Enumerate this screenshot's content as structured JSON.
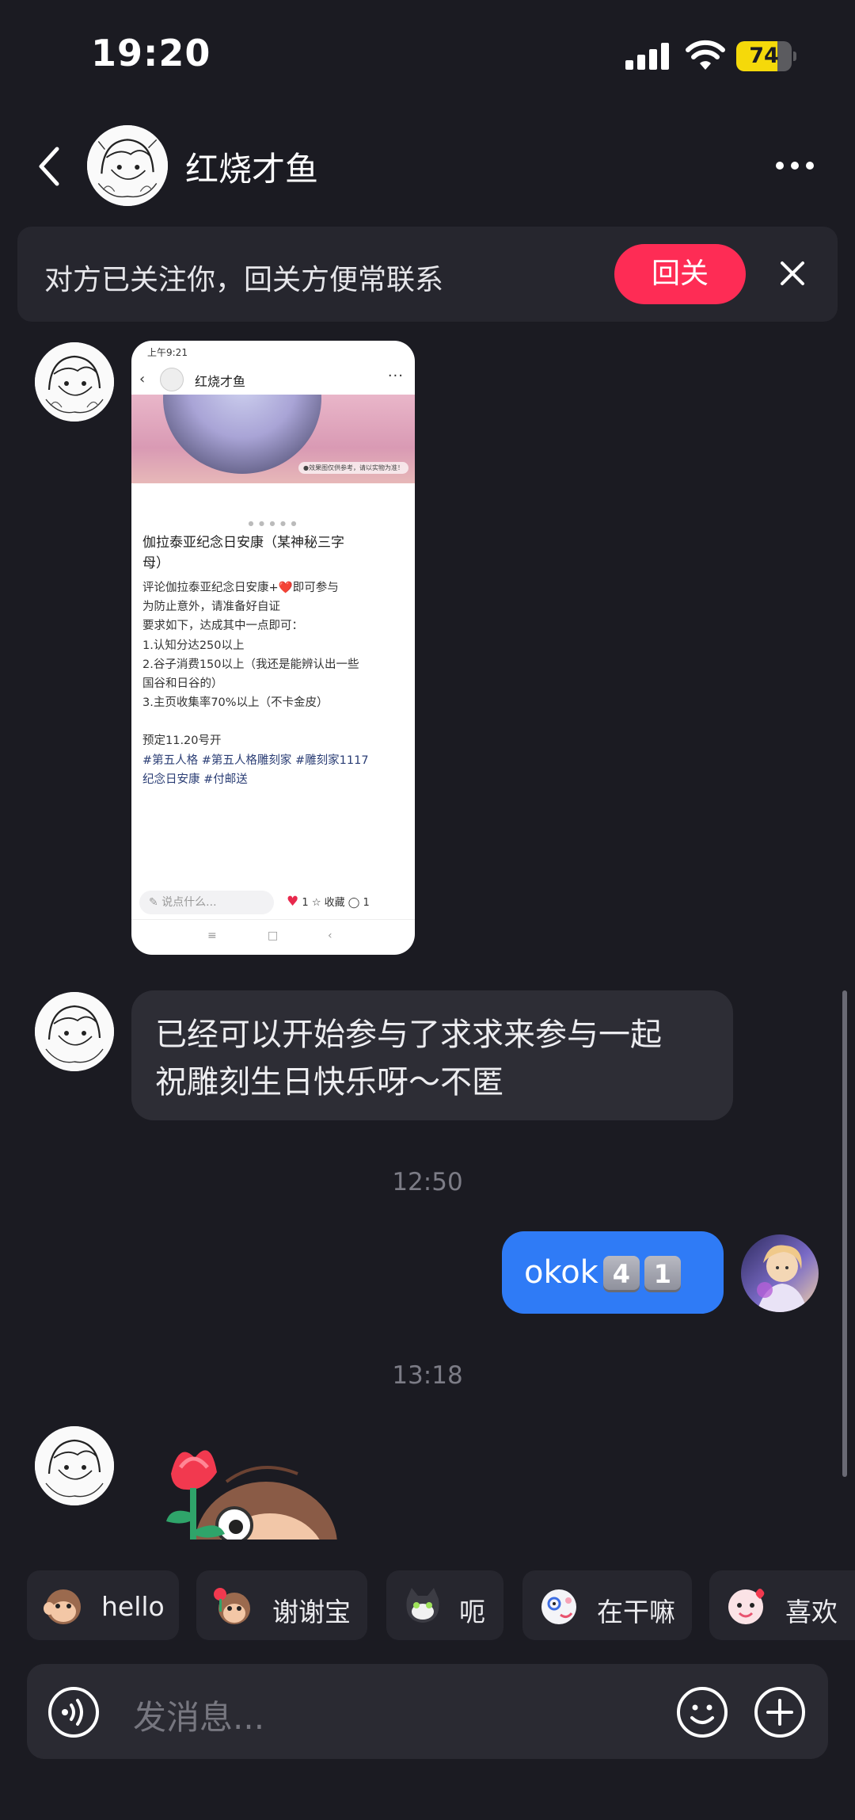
{
  "status_bar": {
    "time": "19:20",
    "battery": "74",
    "battery_level": 0.74
  },
  "header": {
    "title": "红烧才鱼",
    "back_icon": "chevron-left-icon",
    "more_icon": "more-dots-icon"
  },
  "follow_banner": {
    "text": "对方已关注你，回关方便常联系",
    "button": "回关"
  },
  "shared_post": {
    "status_time": "上午9:21",
    "author": "红烧才鱼",
    "title_lines": [
      "伽拉泰亚纪念日安康（某神秘三字",
      "母）"
    ],
    "body_lines": [
      "评论伽拉泰亚纪念日安康+❤️即可参与",
      "为防止意外，请准备好自证",
      "要求如下，达成其中一点即可：",
      "1.认知分达250以上",
      "2.谷子消费150以上（我还是能辨认出一些",
      "国谷和日谷的）",
      "3.主页收集率70%以上（不卡金皮）",
      "",
      "预定11.20号开",
      "#第五人格 #第五人格雕刻家 #雕刻家1117",
      "纪念日安康 #付邮送"
    ],
    "image_tag": "●效果图仅供参考，请以实物为准！",
    "input_placeholder": "说点什么...",
    "likes": "1",
    "collect": "收藏",
    "comments": "1"
  },
  "messages": {
    "incoming_text_lines": [
      "已经可以开始参与了求求来参与一起",
      "祝雕刻生日快乐呀～不匿"
    ],
    "time_1": "12:50",
    "outgoing_text": "okok",
    "outgoing_keycaps": [
      "4",
      "1"
    ],
    "time_2": "13:18"
  },
  "quick_replies": [
    {
      "icon": "monkey-wave-icon",
      "label": "hello"
    },
    {
      "icon": "monkey-flower-icon",
      "label": "谢谢宝"
    },
    {
      "icon": "cat-icon",
      "label": "呃"
    },
    {
      "icon": "peek-sticker-icon",
      "label": "在干嘛"
    },
    {
      "icon": "heart-sticker-icon",
      "label": "喜欢"
    }
  ],
  "composer": {
    "placeholder": "发消息..."
  },
  "colors": {
    "background": "#1b1b22",
    "accent_red": "#fe2c55",
    "outgoing_bubble": "#2f7bf6",
    "incoming_bubble": "#2d2d35"
  }
}
